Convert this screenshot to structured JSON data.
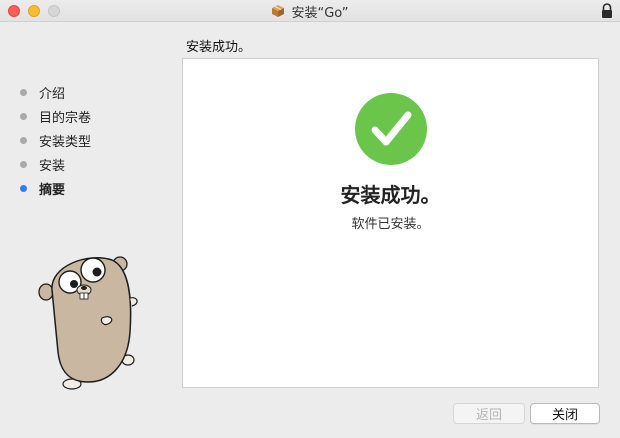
{
  "window": {
    "title": "安装“Go”"
  },
  "heading": "安装成功。",
  "sidebar": {
    "steps": [
      {
        "label": "介绍",
        "active": false
      },
      {
        "label": "目的宗卷",
        "active": false
      },
      {
        "label": "安装类型",
        "active": false
      },
      {
        "label": "安装",
        "active": false
      },
      {
        "label": "摘要",
        "active": true
      }
    ]
  },
  "main": {
    "success_title": "安装成功。",
    "success_subtitle": "软件已安装。"
  },
  "buttons": {
    "back_label": "返回",
    "close_label": "关闭"
  },
  "colors": {
    "success_green": "#6bc54b",
    "active_step": "#2f7df6",
    "inactive_step": "#a9a9a9"
  },
  "icons": {
    "title_icon": "package-icon",
    "lock": "lock-icon",
    "status": "checkmark-icon",
    "mascot": "gopher-illustration"
  }
}
